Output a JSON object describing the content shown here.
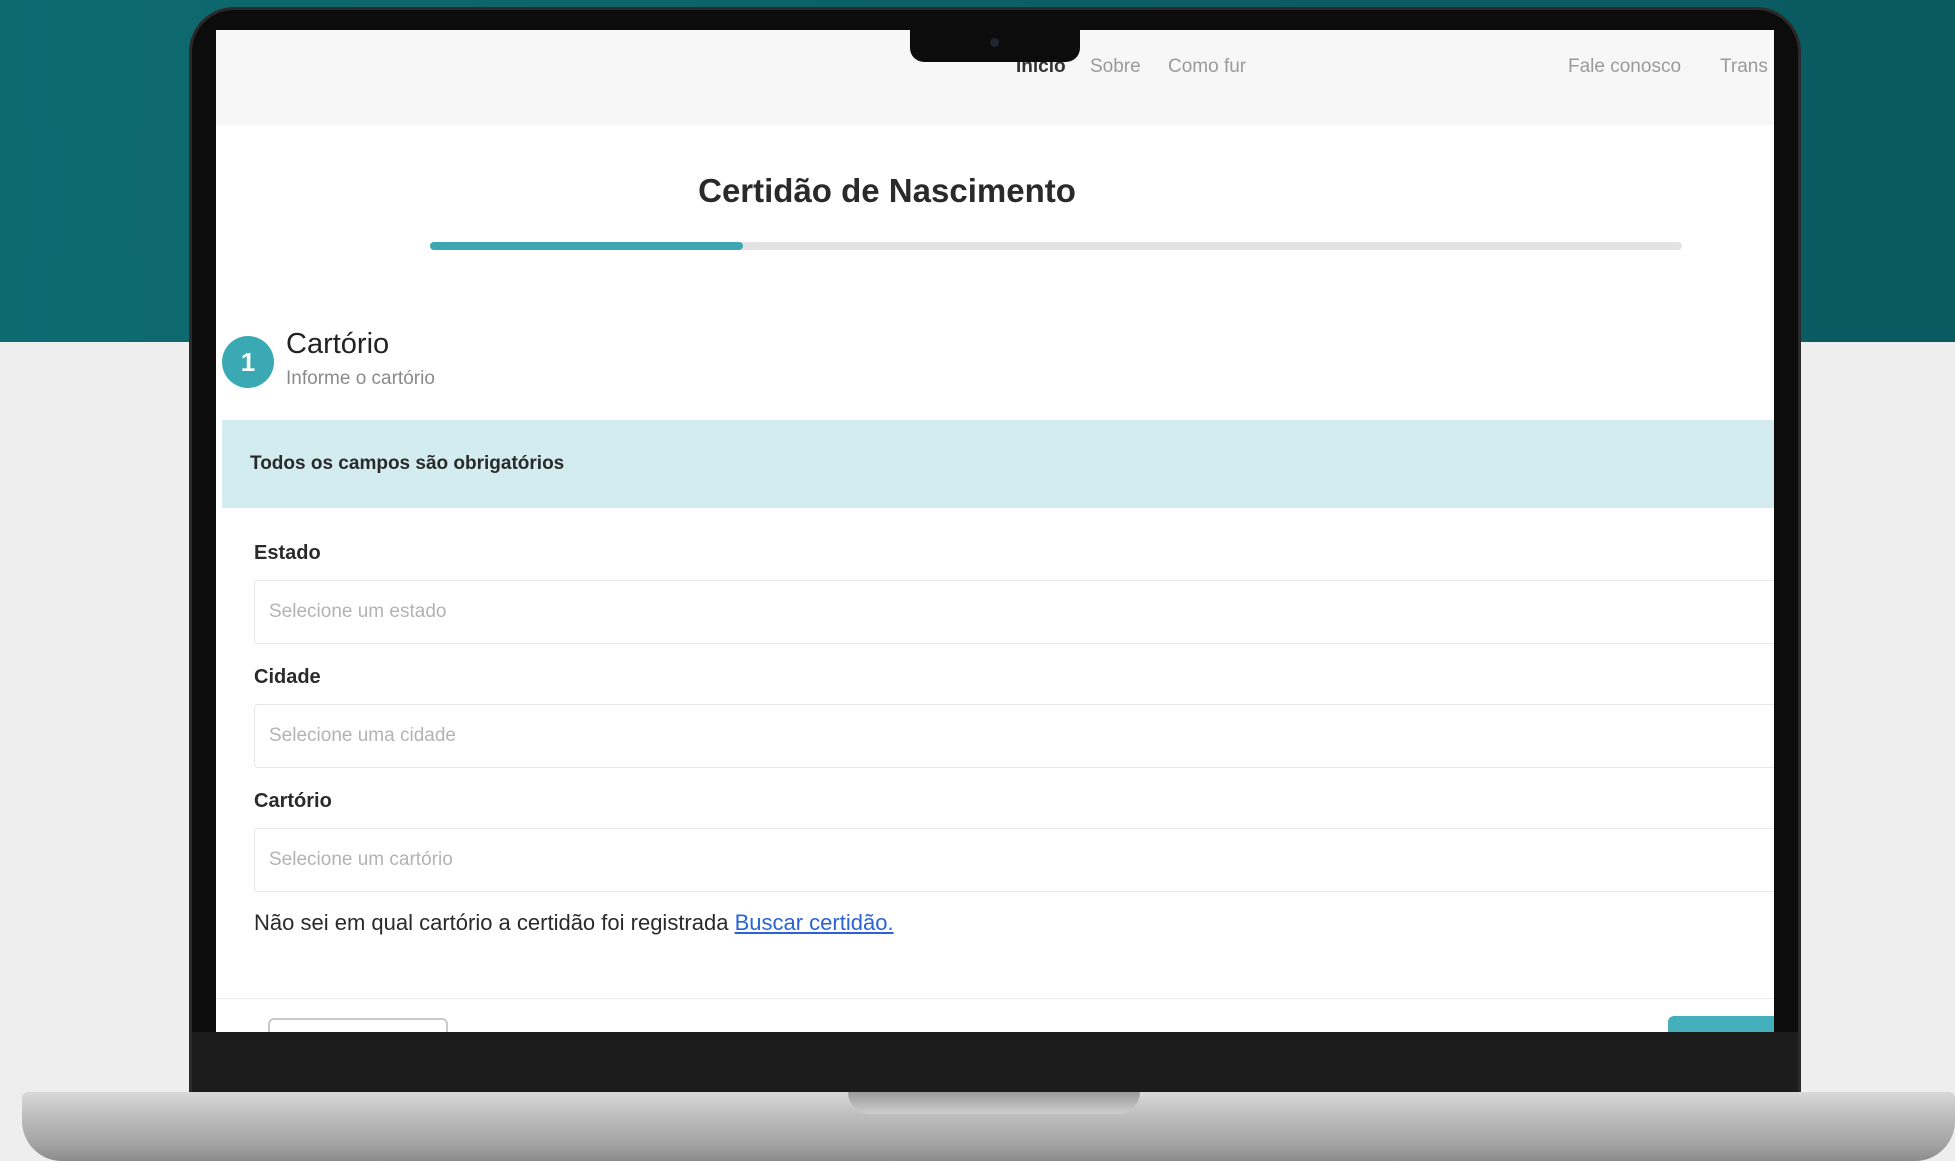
{
  "nav": {
    "items": [
      "Início",
      "Sobre",
      "Como fur",
      "Fale conosco",
      "Trans"
    ]
  },
  "page": {
    "title": "Certidão de Nascimento",
    "progress_percent": 25
  },
  "step": {
    "number": "1",
    "title": "Cartório",
    "subtitle": "Informe o cartório"
  },
  "alert": {
    "text": "Todos os campos são obrigatórios"
  },
  "form": {
    "estado": {
      "label": "Estado",
      "placeholder": "Selecione um estado"
    },
    "cidade": {
      "label": "Cidade",
      "placeholder": "Selecione uma cidade"
    },
    "cartorio": {
      "label": "Cartório",
      "placeholder": "Selecione um cartório"
    }
  },
  "hint": {
    "text": "Não sei em qual cartório a certidão foi registrada",
    "link": "Buscar certidão."
  },
  "colors": {
    "brand_teal": "#0b5d63",
    "accent": "#3ba9b4",
    "alert_bg": "#d3ecf0",
    "link": "#2b63d6"
  }
}
